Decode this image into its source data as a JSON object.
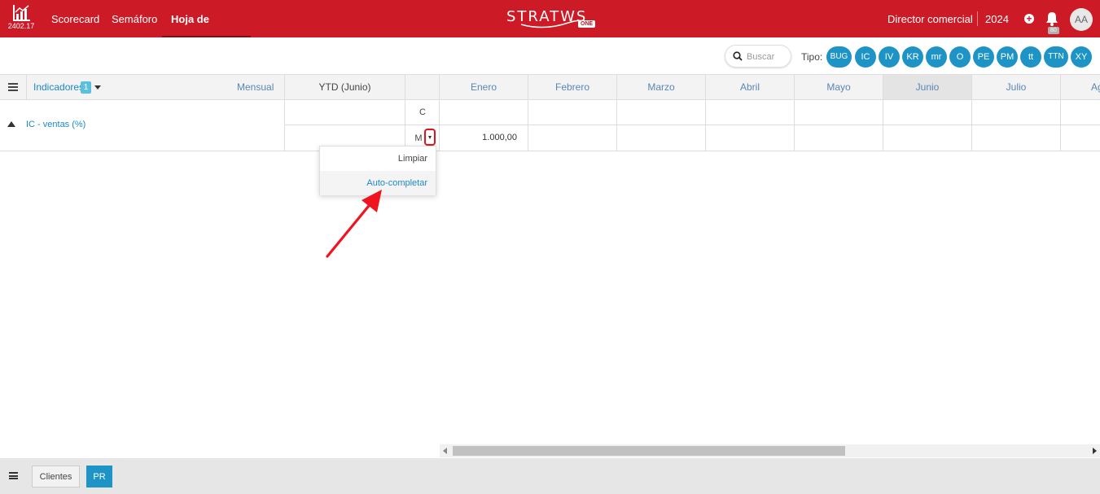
{
  "header": {
    "version": "2402.17",
    "nav": [
      "Scorecard",
      "Semáforo",
      "Hoja de cálculo"
    ],
    "active_nav": "Hoja de cálculo",
    "brand": "STRATWS",
    "brand_suffix": "ONE",
    "role": "Director comercial",
    "year": "2024",
    "notifications": "80",
    "avatar": "AA",
    "brand_color": "#cc1b26"
  },
  "toolbar": {
    "search_placeholder": "Buscar",
    "tipo_label": "Tipo:",
    "chips": [
      "BUG",
      "IC",
      "IV",
      "KR",
      "mr",
      "O",
      "PE",
      "PM",
      "tt",
      "TTN",
      "XY"
    ],
    "chip_color": "#1e94c6"
  },
  "grid": {
    "indicators_label": "Indicadores",
    "indicators_count": "1",
    "period": "Mensual",
    "ytd_label": "YTD (Junio)",
    "months": [
      "Enero",
      "Febrero",
      "Marzo",
      "Abril",
      "Mayo",
      "Junio",
      "Julio",
      "Ag"
    ],
    "highlighted_month": "Junio",
    "rows": [
      {
        "name": "IC - ventas (%)",
        "sub_rows": [
          {
            "type": "C",
            "values": [
              "",
              "",
              "",
              "",
              "",
              "",
              ""
            ]
          },
          {
            "type": "M",
            "values": [
              "1.000,00",
              "",
              "",
              "",
              "",
              "",
              ""
            ]
          }
        ]
      }
    ]
  },
  "dropdown": {
    "items": [
      "Limpiar",
      "Auto-completar"
    ],
    "highlighted": "Auto-completar"
  },
  "footer": {
    "tabs": [
      "Clientes",
      "PR"
    ],
    "active_tab": "PR"
  }
}
